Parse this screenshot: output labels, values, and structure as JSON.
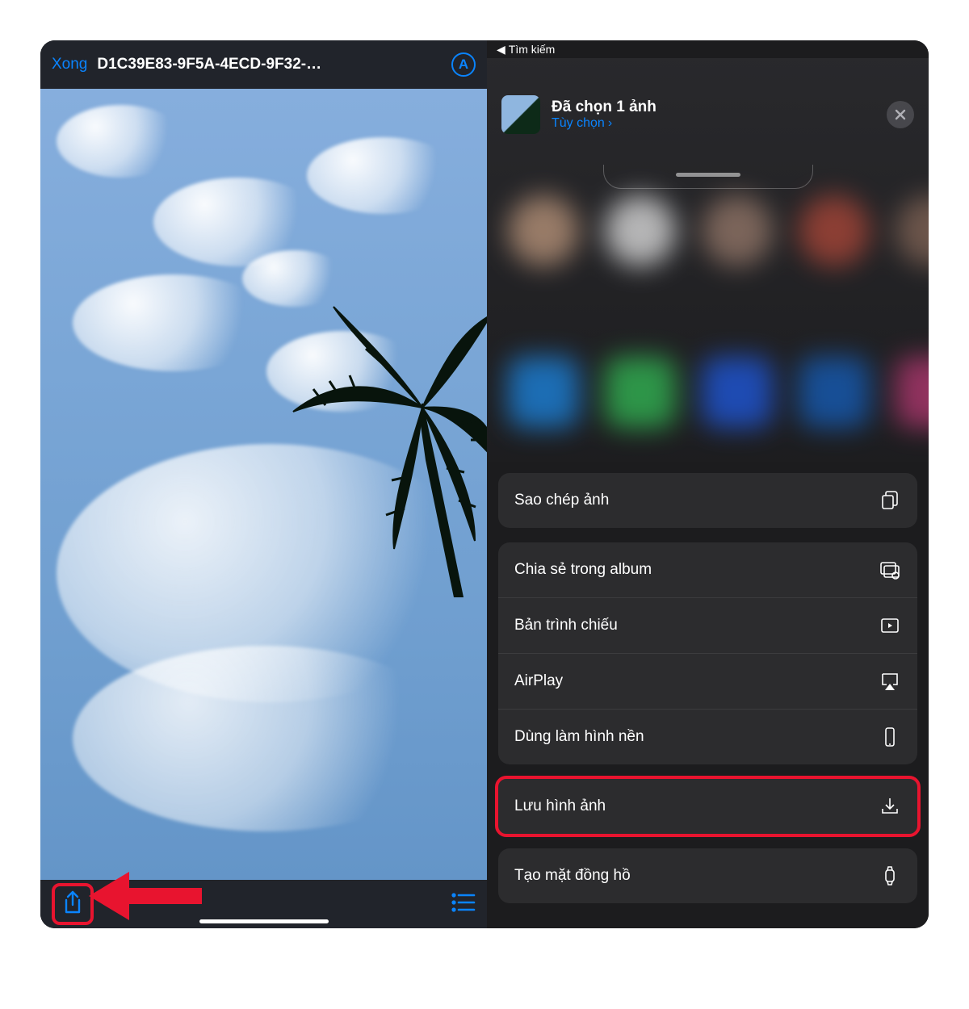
{
  "left": {
    "done_label": "Xong",
    "title": "D1C39E83-9F5A-4ECD-9F32-…",
    "markup_label": "A"
  },
  "right": {
    "status_back": "Tìm kiếm",
    "selected_count_label": "Đã chọn 1 ảnh",
    "options_label": "Tùy chọn",
    "options_chevron": "›",
    "actions": {
      "copy": "Sao chép ảnh",
      "share_album": "Chia sẻ trong album",
      "slideshow": "Bản trình chiếu",
      "airplay": "AirPlay",
      "wallpaper": "Dùng làm hình nền",
      "save": "Lưu hình ảnh",
      "watch": "Tạo mặt đồng hồ"
    }
  },
  "colors": {
    "accent": "#0a84ff",
    "highlight": "#e8142f"
  }
}
